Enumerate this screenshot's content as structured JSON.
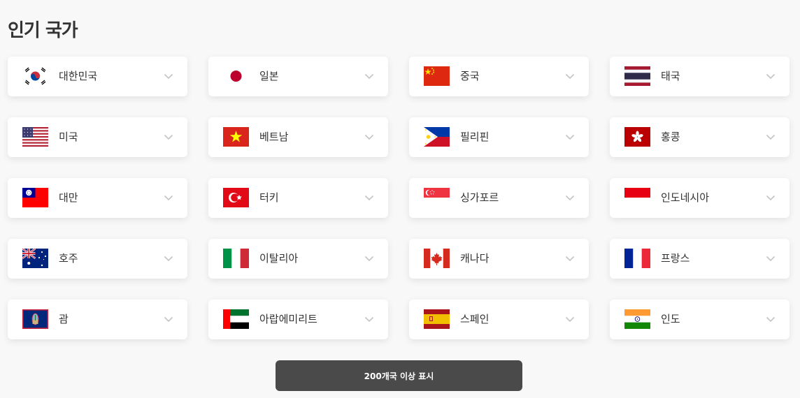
{
  "page": {
    "title": "인기 국가"
  },
  "countries": [
    {
      "name": "대한민국",
      "flag": "korea-flag-icon"
    },
    {
      "name": "일본",
      "flag": "japan-flag-icon"
    },
    {
      "name": "중국",
      "flag": "china-flag-icon"
    },
    {
      "name": "태국",
      "flag": "thailand-flag-icon"
    },
    {
      "name": "미국",
      "flag": "usa-flag-icon"
    },
    {
      "name": "베트남",
      "flag": "vietnam-flag-icon"
    },
    {
      "name": "필리핀",
      "flag": "philippines-flag-icon"
    },
    {
      "name": "홍콩",
      "flag": "hongkong-flag-icon"
    },
    {
      "name": "대만",
      "flag": "taiwan-flag-icon"
    },
    {
      "name": "터키",
      "flag": "turkey-flag-icon"
    },
    {
      "name": "싱가포르",
      "flag": "singapore-flag-icon"
    },
    {
      "name": "인도네시아",
      "flag": "indonesia-flag-icon"
    },
    {
      "name": "호주",
      "flag": "australia-flag-icon"
    },
    {
      "name": "이탈리아",
      "flag": "italy-flag-icon"
    },
    {
      "name": "캐나다",
      "flag": "canada-flag-icon"
    },
    {
      "name": "프랑스",
      "flag": "france-flag-icon"
    },
    {
      "name": "괌",
      "flag": "guam-flag-icon"
    },
    {
      "name": "아랍에미리트",
      "flag": "uae-flag-icon"
    },
    {
      "name": "스페인",
      "flag": "spain-flag-icon"
    },
    {
      "name": "인도",
      "flag": "india-flag-icon"
    }
  ],
  "more_button": {
    "label": "200개국 이상 표시"
  },
  "colors": {
    "button_bg": "#4a4a4a",
    "card_bg": "#ffffff",
    "page_bg": "#f8f8f8"
  }
}
